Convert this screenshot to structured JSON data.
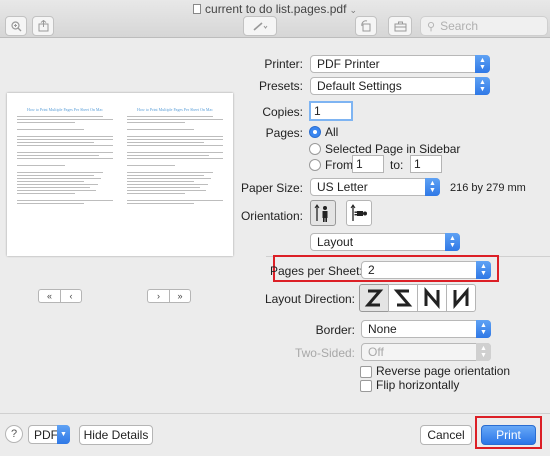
{
  "window": {
    "title": "current to do list.pages.pdf"
  },
  "toolbar": {
    "search_placeholder": "Search"
  },
  "preview": {
    "page_title": "How to Print Multiple Pages Per Sheet On Mac",
    "nav": {
      "first": "«",
      "prev": "‹",
      "next": "›",
      "last": "»"
    }
  },
  "form": {
    "printer_label": "Printer:",
    "printer_value": "PDF Printer",
    "presets_label": "Presets:",
    "presets_value": "Default Settings",
    "copies_label": "Copies:",
    "copies_value": "1",
    "pages_label": "Pages:",
    "pages_all": "All",
    "pages_selected": "Selected Page in Sidebar",
    "from_label": "From:",
    "from_value": "1",
    "to_label": "to:",
    "to_value": "1",
    "paper_label": "Paper Size:",
    "paper_value": "US Letter",
    "paper_dims": "216 by 279 mm",
    "orientation_label": "Orientation:",
    "section_value": "Layout",
    "pps_label": "Pages per Sheet:",
    "pps_value": "2",
    "direction_label": "Layout Direction:",
    "border_label": "Border:",
    "border_value": "None",
    "twosided_label": "Two-Sided:",
    "twosided_value": "Off",
    "reverse_label": "Reverse page orientation",
    "flip_label": "Flip horizontally"
  },
  "footer": {
    "help": "?",
    "pdf": "PDF",
    "hide_details": "Hide Details",
    "cancel": "Cancel",
    "print": "Print"
  },
  "colors": {
    "accent": "#3a86f0",
    "highlight": "#dc1f26",
    "link_title": "#5a9ed8"
  },
  "icons": [
    "sidebar-icon",
    "share-icon",
    "pen-icon",
    "rotate-icon",
    "toolbox-icon",
    "search-icon",
    "portrait-icon",
    "landscape-icon",
    "z-layout-icon",
    "reverse-z-layout-icon",
    "n-layout-icon",
    "reverse-n-layout-icon"
  ]
}
